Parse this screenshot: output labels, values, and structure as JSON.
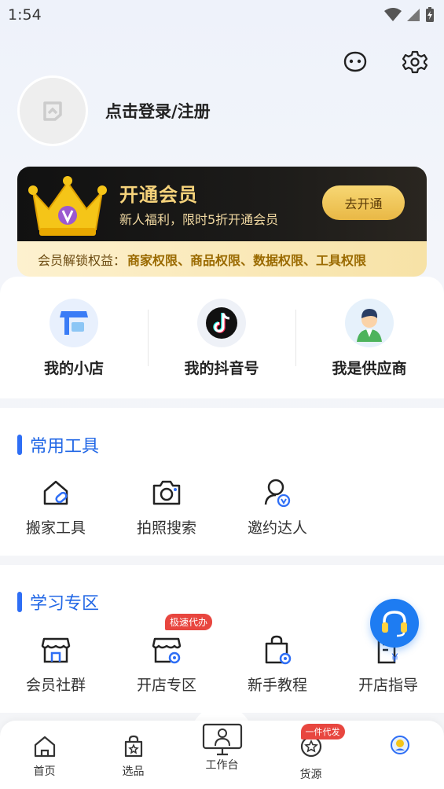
{
  "status_bar": {
    "time": "1:54"
  },
  "header": {
    "login_text": "点击登录/注册"
  },
  "vip": {
    "title": "开通会员",
    "subtitle": "新人福利，限时5折开通会员",
    "button": "去开通",
    "benefits_prefix": "会员解锁权益：",
    "benefits": "商家权限、商品权限、数据权限、工具权限"
  },
  "shortcuts": [
    {
      "label": "我的小店"
    },
    {
      "label": "我的抖音号"
    },
    {
      "label": "我是供应商"
    }
  ],
  "tools": {
    "title": "常用工具",
    "items": [
      {
        "label": "搬家工具"
      },
      {
        "label": "拍照搜索"
      },
      {
        "label": "邀约达人"
      }
    ]
  },
  "study": {
    "title": "学习专区",
    "items": [
      {
        "label": "会员社群"
      },
      {
        "label": "开店专区",
        "badge": "极速代办"
      },
      {
        "label": "新手教程"
      },
      {
        "label": "开店指导"
      }
    ]
  },
  "tabbar": [
    {
      "label": "首页"
    },
    {
      "label": "选品"
    },
    {
      "label": "工作台"
    },
    {
      "label": "货源",
      "badge": "一件代发"
    },
    {
      "label": ""
    }
  ],
  "colors": {
    "accent": "#2167e6",
    "gold": "#f6d37b",
    "badge": "#e8463f"
  }
}
